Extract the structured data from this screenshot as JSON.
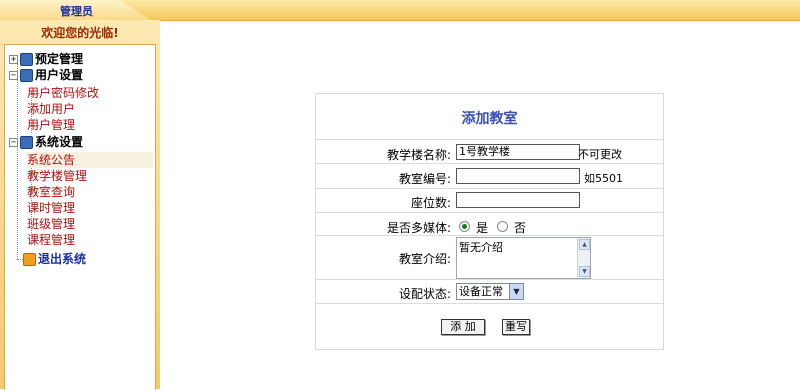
{
  "top_tab": {
    "label": "管理员"
  },
  "sidebar": {
    "welcome": "欢迎您的光临!",
    "tree": [
      {
        "label": "预定管理",
        "children": []
      },
      {
        "label": "用户设置",
        "children": [
          "用户密码修改",
          "添加用户",
          "用户管理"
        ]
      },
      {
        "label": "系统设置",
        "children": [
          "系统公告",
          "教学楼管理",
          "教室查询",
          "课时管理",
          "班级管理",
          "课程管理"
        ]
      },
      {
        "label": "退出系统",
        "children": []
      }
    ]
  },
  "form": {
    "title": "添加教室",
    "building_label": "教学楼名称:",
    "building_value": "1号教学楼",
    "building_hint": "不可更改",
    "room_label": "教室编号:",
    "room_value": "",
    "room_hint": "如5501",
    "seats_label": "座位数:",
    "seats_value": "",
    "multimedia_label": "是否多媒体:",
    "multimedia_yes": "是",
    "multimedia_no": "否",
    "multimedia_selected": "是",
    "intro_label": "教室介绍:",
    "intro_value": "暂无介绍",
    "status_label": "设配状态:",
    "status_value": "设备正常",
    "add_button": "添 加",
    "reset_button": "重写"
  },
  "colors": {
    "accent_blue": "#3a4fb0",
    "link_red": "#b01010",
    "topbar": "#f6c75a"
  }
}
